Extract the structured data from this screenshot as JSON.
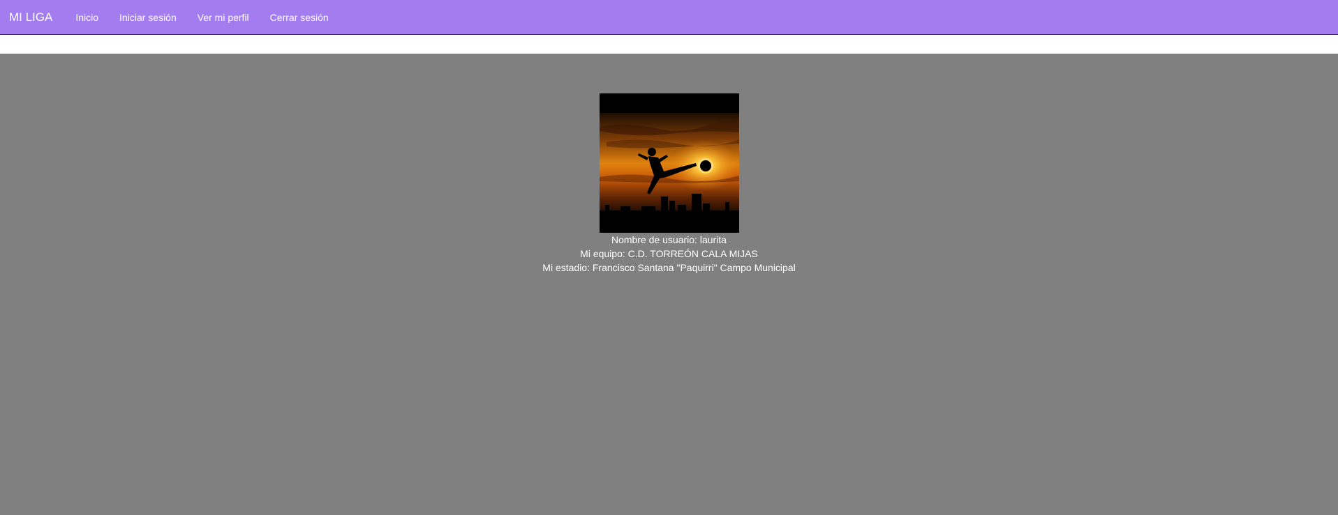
{
  "navbar": {
    "brand": "MI LIGA",
    "links": [
      "Inicio",
      "Iniciar sesión",
      "Ver mi perfil",
      "Cerrar sesión"
    ],
    "background_color": "#a37cf0"
  },
  "profile": {
    "image_icon": "soccer-player-sunset-image",
    "username_line": "Nombre de usuario: laurita",
    "team_line": "Mi equipo: C.D. TORREÓN CALA MIJAS",
    "stadium_line": "Mi estadio: Francisco Santana \"Paquirri\" Campo Municipal"
  },
  "colors": {
    "page_background": "#808080",
    "text": "#ffffff"
  }
}
